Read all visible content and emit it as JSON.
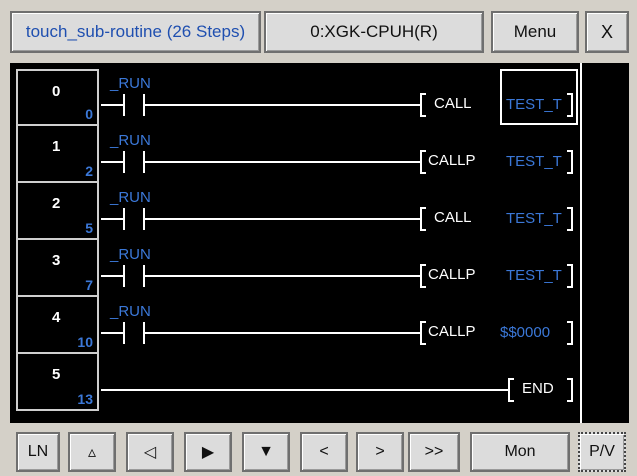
{
  "header": {
    "title": "touch_sub-routine (26 Steps)",
    "cpu": "0:XGK-CPUH(R)",
    "menu_label": "Menu",
    "close_label": "X"
  },
  "ladder": {
    "rows": [
      {
        "step": "0",
        "offset": "0",
        "contact": "_RUN",
        "instruction": "CALL",
        "operand": "TEST_T"
      },
      {
        "step": "1",
        "offset": "2",
        "contact": "_RUN",
        "instruction": "CALLP",
        "operand": "TEST_T"
      },
      {
        "step": "2",
        "offset": "5",
        "contact": "_RUN",
        "instruction": "CALL",
        "operand": "TEST_T"
      },
      {
        "step": "3",
        "offset": "7",
        "contact": "_RUN",
        "instruction": "CALLP",
        "operand": "TEST_T"
      },
      {
        "step": "4",
        "offset": "10",
        "contact": "_RUN",
        "instruction": "CALLP",
        "operand": "$$0000"
      },
      {
        "step": "5",
        "offset": "13",
        "contact": "",
        "instruction": "END",
        "operand": ""
      }
    ]
  },
  "toolbar": {
    "ln": "LN",
    "up": "▵",
    "left": "◁",
    "right": "▶",
    "down": "▼",
    "lt": "<",
    "gt": ">",
    "gtgt": ">>",
    "mon": "Mon",
    "pv": "P/V"
  }
}
